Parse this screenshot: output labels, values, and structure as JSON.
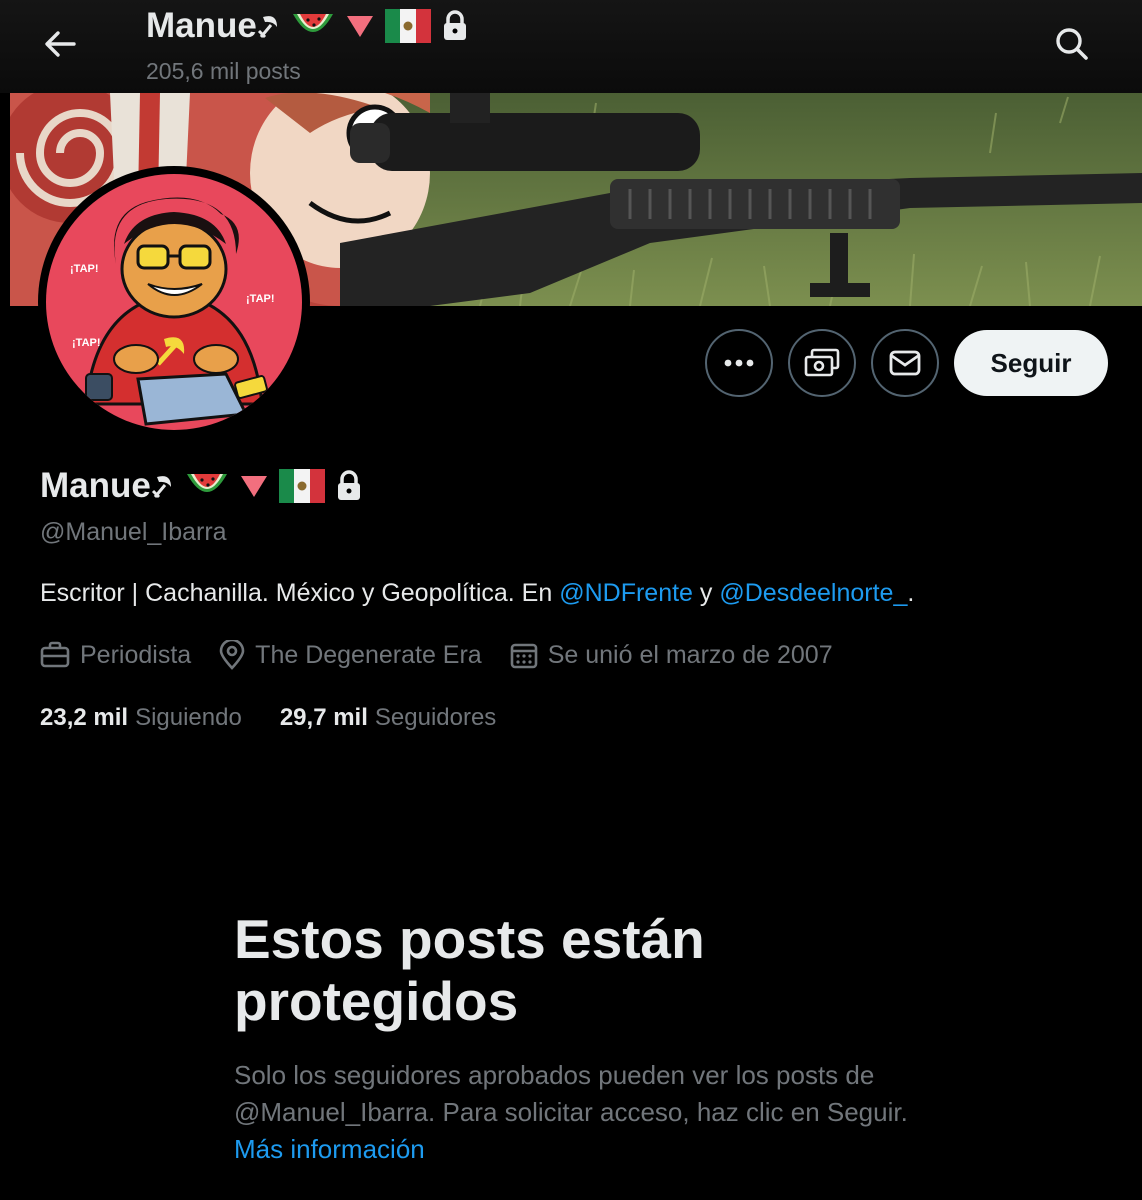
{
  "topbar": {
    "display_name": "Manue",
    "posts_count": "205,6 mil posts"
  },
  "profile": {
    "display_name": "Manue",
    "handle": "@Manuel_Ibarra",
    "bio": {
      "text_1": "Escritor | Cachanilla. México y Geopolítica. En ",
      "mention_1": "@NDFrente",
      "text_2": " y ",
      "mention_2": "@Desdeelnorte_",
      "text_3": "."
    },
    "profession": "Periodista",
    "location": "The Degenerate Era",
    "joined": "Se unió el marzo de 2007",
    "following_count": "23,2 mil",
    "following_label": "Siguiendo",
    "followers_count": "29,7 mil",
    "followers_label": "Seguidores"
  },
  "actions": {
    "follow_label": "Seguir"
  },
  "protected": {
    "title": "Estos posts están protegidos",
    "body": "Solo los seguidores aprobados pueden ver los posts de @Manuel_Ibarra. Para solicitar acceso, haz clic en Seguir. ",
    "more_link": "Más información"
  },
  "avatar_art": {
    "shout_1": "¡TAP!",
    "shout_2": "¡TAP!",
    "shout_3": "¡TAP!"
  },
  "icons": {
    "back": "arrow-left-icon",
    "search": "search-icon",
    "more": "more-icon",
    "subscribe": "money-icon",
    "message": "mail-icon",
    "name_badges": [
      "sickle-icon",
      "watermelon-icon",
      "red-triangle-icon",
      "mexico-flag-icon",
      "lock-icon"
    ],
    "profession": "briefcase-icon",
    "location": "location-pin-icon",
    "joined": "calendar-icon"
  },
  "colors": {
    "background": "#000000",
    "text_primary": "#e7e9ea",
    "text_secondary": "#71767b",
    "link": "#1d9bf0",
    "button_border": "#536471",
    "follow_bg": "#eff3f4",
    "avatar_bg": "#e8485c"
  }
}
